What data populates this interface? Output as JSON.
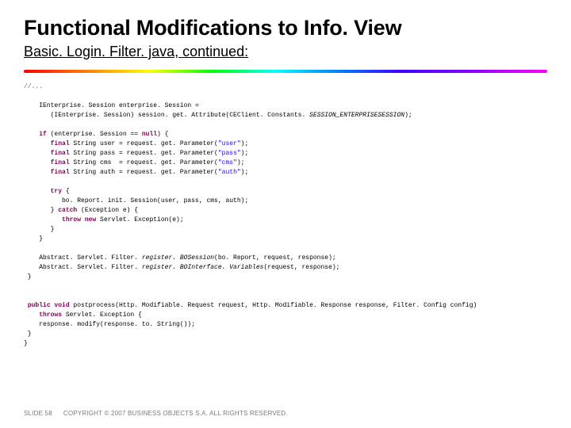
{
  "header": {
    "title": "Functional Modifications to Info. View",
    "subtitle": "Basic. Login. Filter. java, continued:"
  },
  "code": {
    "c0": "//...",
    "c1a": "    IEnterprise. Session enterprise. Session =",
    "c1b": "       (IEnterprise. Session) session. get. Attribute(CEClient. Constants.",
    "c1c": " SESSION_ENTERPRISESESSION",
    "c1d": ");",
    "c2a": "    ",
    "kw_if": "if",
    "c2b": " (enterprise. Session == ",
    "kw_null": "null",
    "c2c": ") {",
    "c3a": "       ",
    "kw_f1": "final",
    "c3b": " String user = request. get. Parameter(",
    "s_user": "\"user\"",
    "c3c": ");",
    "c4a": "       ",
    "kw_f2": "final",
    "c4b": " String pass = request. get. Parameter(",
    "s_pass": "\"pass\"",
    "c4c": ");",
    "c5a": "       ",
    "kw_f3": "final",
    "c5b": " String cms  = request. get. Parameter(",
    "s_cms": "\"cms\"",
    "c5c": ");",
    "c6a": "       ",
    "kw_f4": "final",
    "c6b": " String auth = request. get. Parameter(",
    "s_auth": "\"auth\"",
    "c6c": ");",
    "c7a": "       ",
    "kw_try": "try",
    "c7b": " {",
    "c8": "          bo. Report. init. Session(user, pass, cms, auth);",
    "c9a": "       } ",
    "kw_catch": "catch",
    "c9b": " (Exception e) {",
    "c10a": "          ",
    "kw_throw": "throw new",
    "c10b": " Servlet. Exception(e);",
    "c11": "       }",
    "c12": "    }",
    "c13a": "    Abstract. Servlet. Filter.",
    "c13b": " register. BOSession",
    "c13c": "(bo. Report, request, response);",
    "c14a": "    Abstract. Servlet. Filter.",
    "c14b": " register. BOInterface. Variables",
    "c14c": "(request, response);",
    "c15": " }",
    "c16a": " ",
    "kw_pub": "public void",
    "c16b": " postprocess(Http. Modifiable. Request request, Http. Modifiable. Response response, Filter. Config config)",
    "c17a": "    ",
    "kw_throws": "throws",
    "c17b": " Servlet. Exception {",
    "c18": "    response. modify(response. to. String());",
    "c19": " }",
    "c20": "}"
  },
  "footer": {
    "slide": "SLIDE 58",
    "copyright": "COPYRIGHT © 2007 BUSINESS OBJECTS S.A. ALL RIGHTS RESERVED."
  }
}
